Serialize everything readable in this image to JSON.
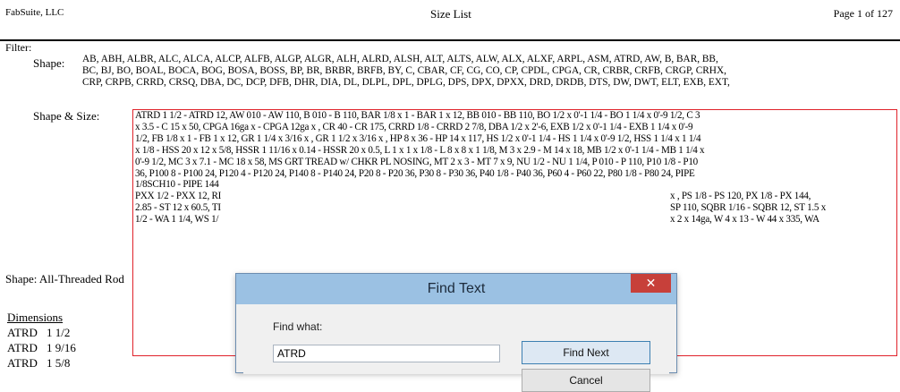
{
  "header": {
    "company": "FabSuite, LLC",
    "title": "Size List",
    "page": "Page 1 of 127"
  },
  "filter": {
    "title": "Filter:",
    "shape_label": "Shape:",
    "shape_lines": [
      "AB, ABH, ALBR, ALC, ALCA, ALCP, ALFB, ALGP, ALGR, ALH, ALRD, ALSH, ALT, ALTS, ALW, ALX, ALXF, ARPL, ASM, ATRD, AW, B, BAR, BB,",
      "BC, BJ, BO, BOAL, BOCA, BOG, BOSA, BOSS, BP, BR, BRBR, BRFB, BY, C, CBAR, CF, CG, CO, CP, CPDL, CPGA, CR, CRBR, CRFB, CRGP, CRHX,",
      "CRP, CRPB, CRRD, CRSQ, DBA, DC, DCP, DFB, DHR, DIA, DL, DLPL, DPL, DPLG, DPS, DPX, DPXX, DRD, DRDB, DTS, DW, DWT, ELT, EXB, EXT,"
    ],
    "size_label": "Shape & Size:",
    "size_lines": [
      "ATRD 1 1/2 - ATRD 12, AW 010 - AW 110, B 010 - B 110, BAR 1/8 x 1 - BAR 1 x 12, BB 010 - BB 110, BO 1/2 x 0'-1 1/4 - BO 1 1/4 x 0'-9 1/2, C 3",
      "x 3.5 - C 15 x 50, CPGA 16ga x - CPGA 12ga x , CR 40 - CR 175, CRRD 1/8 - CRRD 2 7/8, DBA 1/2 x 2'-6, EXB 1/2 x 0'-1 1/4 - EXB 1 1/4 x 0'-9",
      "1/2, FB 1/8 x 1 - FB 1 x 12, GR 1 1/4 x 3/16 x , GR 1 1/2 x 3/16 x , HP 8 x 36 - HP 14 x 117, HS 1/2 x 0'-1 1/4 - HS 1 1/4 x 0'-9 1/2, HSS 1 1/4 x 1 1/4",
      "x 1/8 - HSS 20 x 12 x 5/8, HSSR 1 11/16 x 0.14 - HSSR 20 x 0.5, L 1 x 1 x 1/8 - L 8 x 8 x 1 1/8, M 3 x 2.9 - M 14 x 18, MB 1/2 x 0'-1 1/4 - MB 1 1/4 x",
      "0'-9 1/2, MC 3 x 7.1 - MC 18 x 58, MS GRT TREAD w/ CHKR PL NOSING, MT 2 x 3 - MT 7 x 9, NU 1/2 - NU 1 1/4, P 010 - P 110, P10 1/8 - P10",
      "36, P100 8 - P100 24, P120 4 - P120 24, P140 8 - P140 24, P20 8 - P20 36, P30 8 - P30 36, P40 1/8 - P40 36, P60 4 - P60 22, P80 1/8 - P80 24, PIPE",
      "1/8SCH10 - PIPE 144",
      "PXX 1/2 - PXX 12, RI",
      "2.85 - ST 12 x 60.5, TI",
      "1/2 - WA 1 1/4, WS 1/"
    ],
    "size_lines_right": [
      "x , PS 1/8 - PS 120, PX 1/8 - PX 144,",
      "SP 110, SQBR 1/16 - SQBR 12, ST 1.5 x",
      "x 2 x 14ga, W 4 x 13 - W 44 x 335, WA"
    ]
  },
  "section": {
    "shape_line": "Shape: All-Threaded Rod",
    "dims_header": "Dimensions",
    "dims": [
      {
        "shape": "ATRD",
        "size": "1 1/2"
      },
      {
        "shape": "ATRD",
        "size": "1 9/16"
      },
      {
        "shape": "ATRD",
        "size": "1 5/8"
      }
    ]
  },
  "dialog": {
    "title": "Find Text",
    "close": "✕",
    "label": "Find what:",
    "value": "ATRD",
    "find_next": "Find Next",
    "cancel": "Cancel"
  },
  "colors": {
    "highlight_border": "#e0222a",
    "dialog_titlebar": "#9bc1e3",
    "close_button": "#c7403a"
  }
}
